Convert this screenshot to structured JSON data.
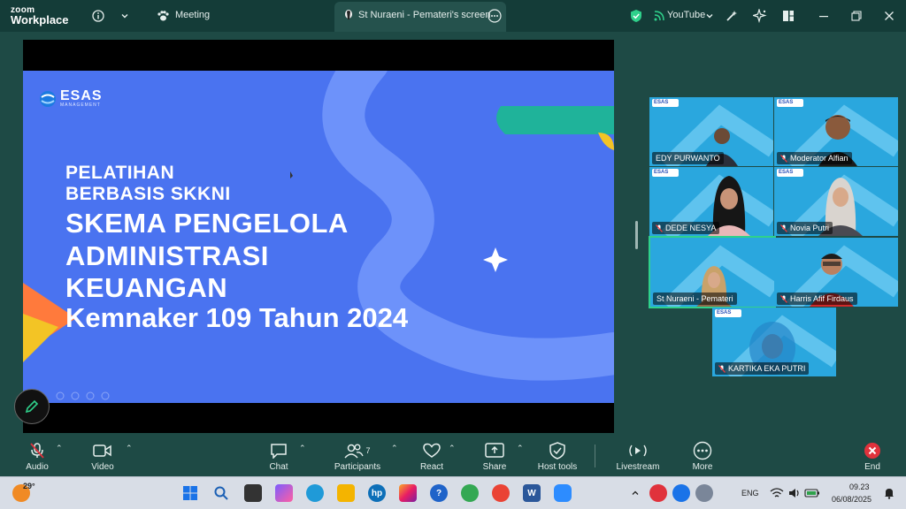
{
  "app": {
    "logo_line1": "zoom",
    "logo_line2": "Workplace",
    "meeting_tab": "Meeting",
    "screen_tab": "St Nuraeni - Pemateri's screen",
    "youtube_label": "YouTube"
  },
  "slide": {
    "brand": "ESAS",
    "brand_sub": "MANAGEMENT",
    "line1": "PELATIHAN",
    "line2": "BERBASIS SKKNI",
    "line3": "SKEMA PENGELOLA",
    "line4": "ADMINISTRASI",
    "line5": "KEUANGAN",
    "line6": "Kemnaker 109 Tahun 2024"
  },
  "participants": [
    {
      "name": "EDY PURWANTO",
      "muted": false
    },
    {
      "name": "Moderator Alfian",
      "muted": true
    },
    {
      "name": "DEDE NESYA",
      "muted": true
    },
    {
      "name": "Novia Putri",
      "muted": true
    },
    {
      "name": "St Nuraeni - Pemateri",
      "muted": false
    },
    {
      "name": "Harris Afif Firdaus",
      "muted": true
    },
    {
      "name": "KARTIKA EKA PUTRI",
      "muted": true
    }
  ],
  "toolbar": {
    "audio": "Audio",
    "video": "Video",
    "chat": "Chat",
    "participants": "Participants",
    "participants_count": "7",
    "react": "React",
    "share": "Share",
    "host_tools": "Host tools",
    "livestream": "Livestream",
    "more": "More",
    "end": "End"
  },
  "taskbar": {
    "weather": "29°",
    "lang": "ENG",
    "time": "09.23",
    "date": "06/08/2025"
  },
  "colors": {
    "zoom_bg": "#1e4a45",
    "slide_blue": "#4a73f0",
    "tile_blue": "#2aa7de",
    "active_green": "#2fd18b",
    "end_red": "#e0323c"
  }
}
